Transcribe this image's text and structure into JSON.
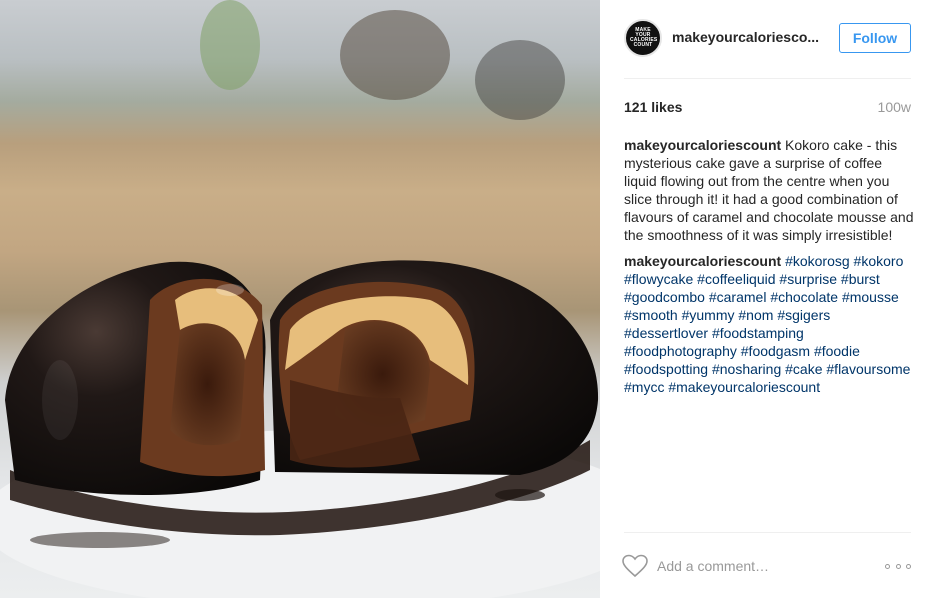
{
  "post": {
    "username": "makeyourcaloriesco...",
    "avatar_text": "MAKE YOUR CALORIES COUNT",
    "follow_label": "Follow",
    "likes": "121 likes",
    "age": "100w",
    "caption": {
      "user": "makeyourcaloriescount",
      "text": " Kokoro cake - this mysterious cake gave a surprise of coffee liquid flowing out from the centre when you slice through it! it had a good combination of flavours of caramel and chocolate mousse and the smoothness of it was simply irresistible!"
    },
    "tag_comment": {
      "user": "makeyourcaloriescount",
      "tags": [
        "#kokorosg",
        "#kokoro",
        "#flowycake",
        "#coffeeliquid",
        "#surprise",
        "#burst",
        "#goodcombo",
        "#caramel",
        "#chocolate",
        "#mousse",
        "#smooth",
        "#yummy",
        "#nom",
        "#sgigers",
        "#dessertlover",
        "#foodstamping",
        "#foodphotography",
        "#foodgasm",
        "#foodie",
        "#foodspotting",
        "#nosharing",
        "#cake",
        "#flavoursome",
        "#mycc",
        "#makeyourcaloriescount"
      ]
    },
    "comment_placeholder": "Add a comment…"
  },
  "icons": {
    "like": "heart-icon",
    "more": "more-options-icon"
  },
  "colors": {
    "accent": "#3897f0",
    "hashtag": "#003569",
    "muted": "#999999"
  }
}
